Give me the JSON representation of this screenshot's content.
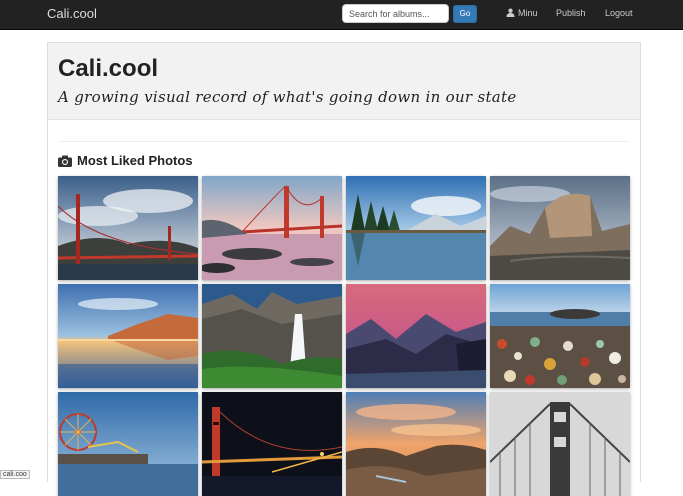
{
  "navbar": {
    "brand": "Cali.cool",
    "search_placeholder": "Search for albums...",
    "go_label": "Go",
    "user_label": "Minu",
    "publish_label": "Publish",
    "logout_label": "Logout"
  },
  "header": {
    "title": "Cali.cool",
    "tagline": "A growing visual record of what's going down in our state"
  },
  "section": {
    "title": "Most Liked Photos",
    "icon": "camera-icon"
  },
  "photos": [
    "golden-gate-bridge-clouds",
    "golden-gate-bridge-sunset-beach",
    "lake-tahoe-pines",
    "half-dome-yosemite",
    "coastal-cliff-sunset-reflection",
    "yosemite-waterfall",
    "mountain-lake-dusk",
    "glass-beach-pebbles",
    "santa-monica-pier",
    "golden-gate-bridge-night",
    "rocky-coast-sunset",
    "golden-gate-tower-bw"
  ],
  "status_bar": "cali.coo"
}
